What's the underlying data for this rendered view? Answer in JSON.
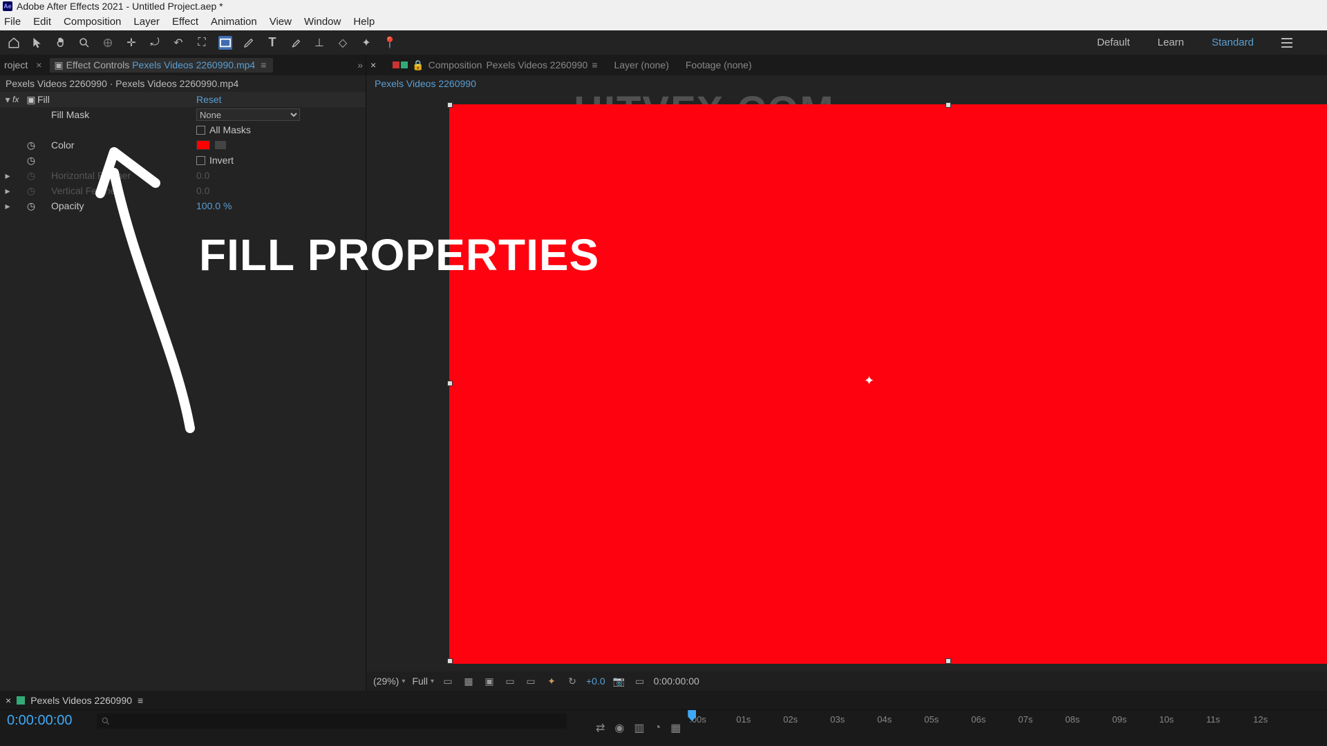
{
  "titlebar": {
    "app": "Adobe After Effects 2021",
    "project": "Untitled Project.aep *"
  },
  "menu": {
    "file": "File",
    "edit": "Edit",
    "composition": "Composition",
    "layer": "Layer",
    "effect": "Effect",
    "animation": "Animation",
    "view": "View",
    "window": "Window",
    "help": "Help"
  },
  "workspaces": {
    "default": "Default",
    "learn": "Learn",
    "standard": "Standard"
  },
  "leftpanel": {
    "tab_project": "roject",
    "tab_effect": "Effect Controls",
    "tab_effect_src": "Pexels Videos 2260990.mp4",
    "sub": "Pexels Videos 2260990 · Pexels Videos 2260990.mp4",
    "effect_name": "Fill",
    "reset": "Reset",
    "fillmask_label": "Fill Mask",
    "fillmask_val": "None",
    "allmasks": "All Masks",
    "color_label": "Color",
    "invert": "Invert",
    "hfeather": "Horizontal Feather",
    "hfeather_val": "0.0",
    "vfeather": "Vertical Feather",
    "vfeather_val": "0.0",
    "opacity": "Opacity",
    "opacity_val": "100.0",
    "opacity_unit": "%"
  },
  "viewer": {
    "comp_label": "Composition",
    "comp_name": "Pexels Videos 2260990",
    "layer_tab": "Layer (none)",
    "footage_tab": "Footage (none)",
    "bread": "Pexels Videos 2260990",
    "watermark": "HITVFX.COM"
  },
  "viewer_footer": {
    "mag": "(29%)",
    "res": "Full",
    "exposure": "+0.0",
    "time": "0:00:00:00"
  },
  "timeline": {
    "tab": "Pexels Videos 2260990",
    "timecode": "0:00:00:00",
    "ticks": [
      ":00s",
      "01s",
      "02s",
      "03s",
      "04s",
      "05s",
      "06s",
      "07s",
      "08s",
      "09s",
      "10s",
      "11s",
      "12s"
    ]
  },
  "annotation": {
    "text": "FILL PROPERTIES"
  }
}
